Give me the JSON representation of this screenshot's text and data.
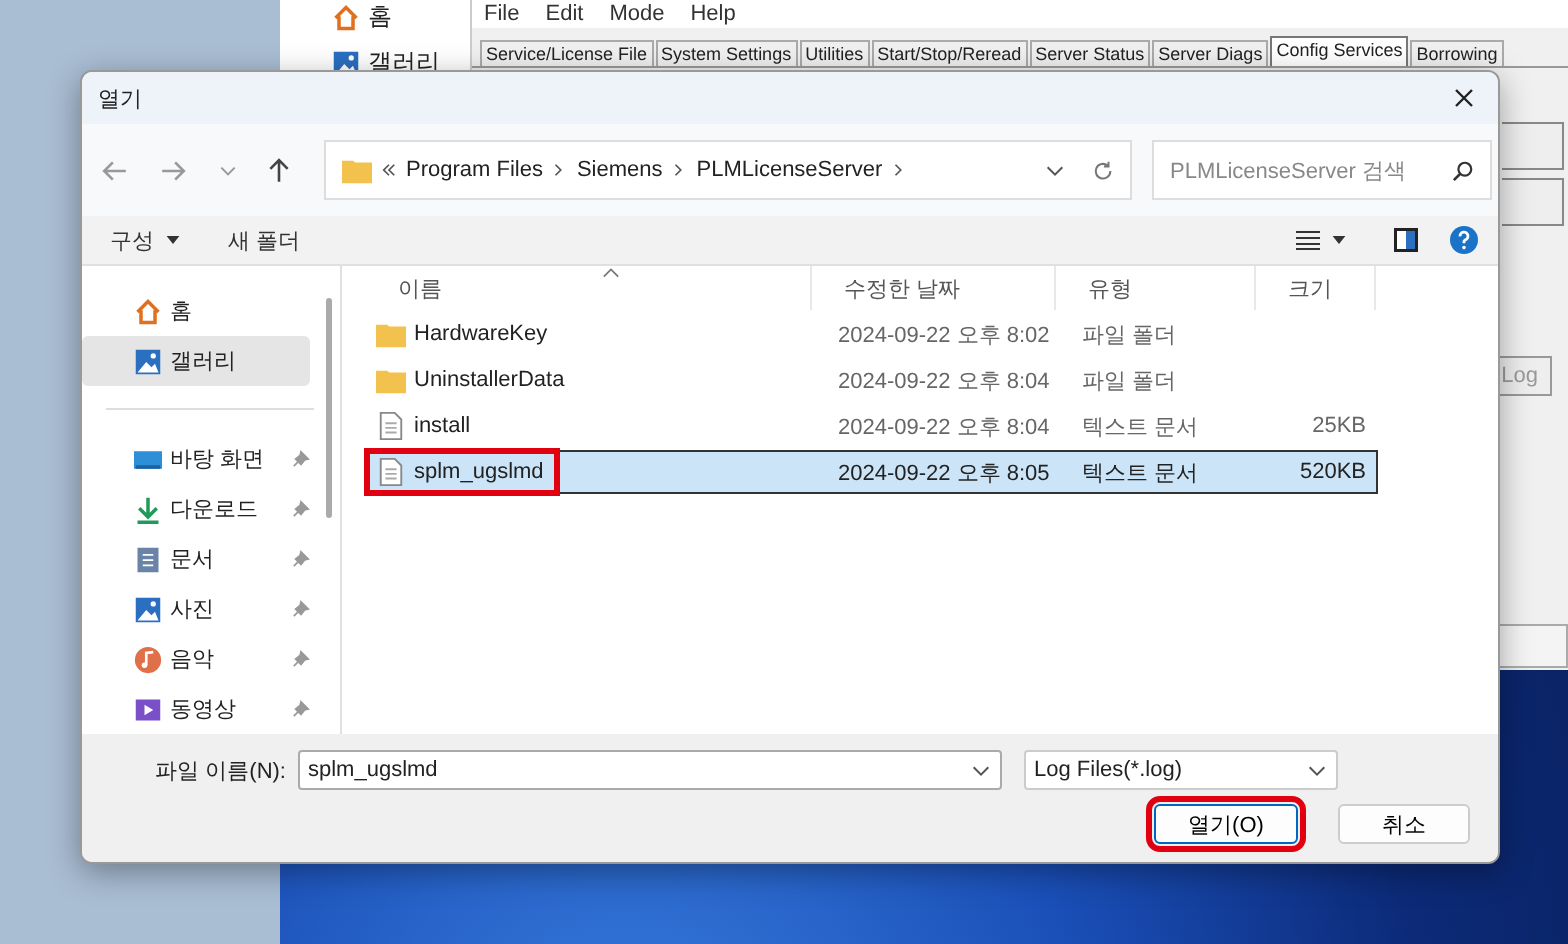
{
  "background_explorer": {
    "items": [
      {
        "label": "홈",
        "kind": "home"
      },
      {
        "label": "갤러리",
        "kind": "gallery"
      }
    ]
  },
  "lmtools": {
    "menu": [
      "File",
      "Edit",
      "Mode",
      "Help"
    ],
    "tabs": [
      {
        "label": "Service/License File",
        "selected": false
      },
      {
        "label": "System Settings",
        "selected": false
      },
      {
        "label": "Utilities",
        "selected": false
      },
      {
        "label": "Start/Stop/Reread",
        "selected": false
      },
      {
        "label": "Server Status",
        "selected": false
      },
      {
        "label": "Server Diags",
        "selected": false
      },
      {
        "label": "Config Services",
        "selected": true
      },
      {
        "label": "Borrowing",
        "selected": false
      }
    ],
    "log_button": "Log"
  },
  "dialog": {
    "title": "열기",
    "address": [
      "Program Files",
      "Siemens",
      "PLMLicenseServer"
    ],
    "search": {
      "placeholder": "PLMLicenseServer 검색"
    },
    "toolbar": {
      "organize": "구성",
      "new_folder": "새 폴더"
    },
    "sidebar": [
      {
        "label": "홈",
        "kind": "home",
        "pinned": false,
        "selected": false
      },
      {
        "label": "갤러리",
        "kind": "gallery",
        "pinned": false,
        "selected": true
      },
      {
        "label": "바탕 화면",
        "kind": "desktop",
        "pinned": true,
        "selected": false
      },
      {
        "label": "다운로드",
        "kind": "download",
        "pinned": true,
        "selected": false
      },
      {
        "label": "문서",
        "kind": "document",
        "pinned": true,
        "selected": false
      },
      {
        "label": "사진",
        "kind": "gallery",
        "pinned": true,
        "selected": false
      },
      {
        "label": "음악",
        "kind": "music",
        "pinned": true,
        "selected": false
      },
      {
        "label": "동영상",
        "kind": "video",
        "pinned": true,
        "selected": false
      }
    ],
    "columns": [
      "이름",
      "수정한 날짜",
      "유형",
      "크기"
    ],
    "files": [
      {
        "kind": "folder",
        "name": "HardwareKey",
        "modified": "2024-09-22 오후 8:02",
        "type": "파일 폴더",
        "selected": false,
        "annotated": false
      },
      {
        "kind": "folder",
        "name": "UninstallerData",
        "modified": "2024-09-22 오후 8:04",
        "type": "파일 폴더",
        "selected": false,
        "annotated": false
      },
      {
        "kind": "text",
        "name": "install",
        "modified": "2024-09-22 오후 8:04",
        "type": "텍스트 문서",
        "size": "25KB",
        "selected": false,
        "annotated": false
      },
      {
        "kind": "text",
        "name": "splm_ugslmd",
        "modified": "2024-09-22 오후 8:05",
        "type": "텍스트 문서",
        "size": "520KB",
        "selected": true,
        "annotated": true
      }
    ],
    "filename_label": "파일 이름(N):",
    "filename_value": "splm_ugslmd",
    "filter": "Log Files(*.log)",
    "buttons": [
      {
        "label": "열기(O)",
        "kind": "primary",
        "annotated": true
      },
      {
        "label": "취소",
        "kind": "secondary",
        "annotated": false
      }
    ]
  }
}
